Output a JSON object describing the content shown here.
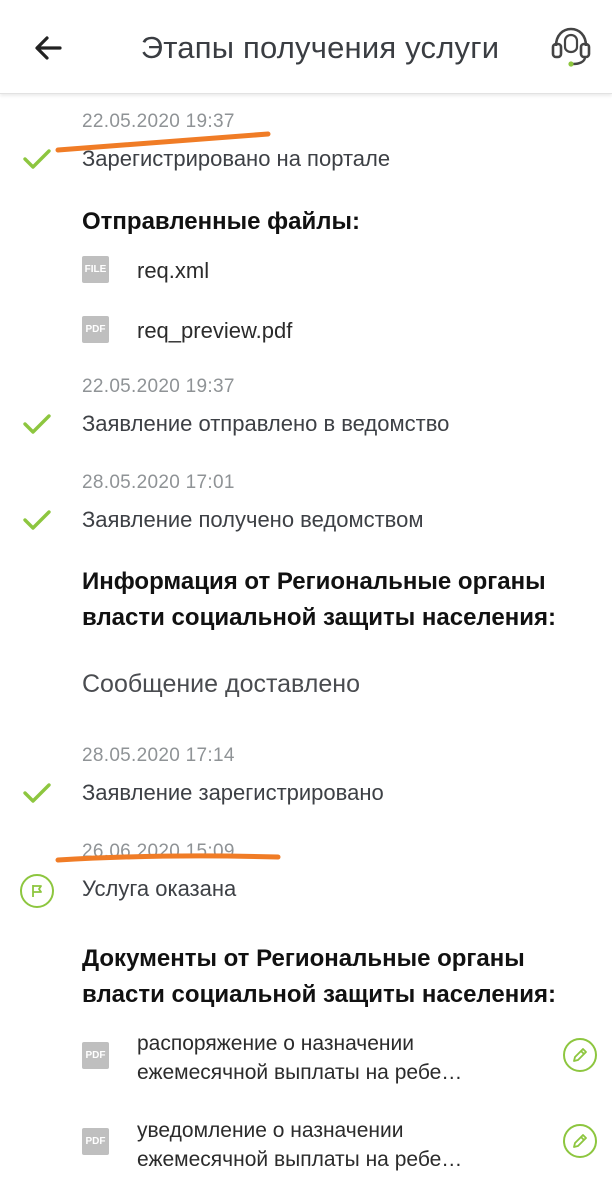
{
  "header": {
    "title": "Этапы получения услуги",
    "back_icon": "arrow-left-icon",
    "support_icon": "headset-icon"
  },
  "colors": {
    "accent_green": "#8dc63f",
    "annotation_orange": "#f07c26",
    "date_gray": "#8f9396"
  },
  "timeline": {
    "step1": {
      "date": "22.05.2020 19:37",
      "status": "Зарегистрировано на портале"
    },
    "sent_files": {
      "heading": "Отправленные файлы:",
      "files": [
        {
          "badge": "FILE",
          "name": "req.xml"
        },
        {
          "badge": "PDF",
          "name": "req_preview.pdf"
        }
      ]
    },
    "step2": {
      "date": "22.05.2020 19:37",
      "status": "Заявление отправлено в ведомство"
    },
    "step3": {
      "date": "28.05.2020 17:01",
      "status": "Заявление получено ведомством"
    },
    "info": {
      "heading_line1": "Информация от Региональные органы",
      "heading_line2": "власти социальной защиты населения:",
      "message": "Сообщение доставлено"
    },
    "step4": {
      "date": "28.05.2020 17:14",
      "status": "Заявление зарегистрировано"
    },
    "step5": {
      "date": "26.06.2020 15:09",
      "status": "Услуга оказана"
    },
    "documents": {
      "heading_line1": "Документы от Региональные органы",
      "heading_line2": "власти социальной защиты населения:",
      "items": [
        {
          "badge": "PDF",
          "line1": "распоряжение о назначении",
          "line2": "ежемесячной выплаты на ребе…"
        },
        {
          "badge": "PDF",
          "line1": "уведомление о назначении",
          "line2": "ежемесячной выплаты на ребе…"
        }
      ]
    }
  }
}
